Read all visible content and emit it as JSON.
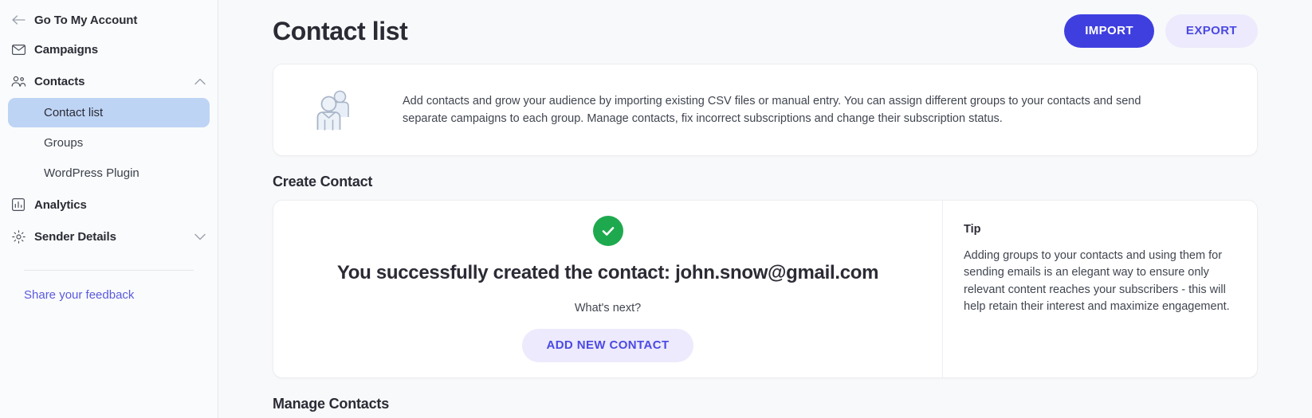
{
  "sidebar": {
    "back_link": {
      "label": "Go To My Account",
      "icon": "arrow-left-icon"
    },
    "groups": [
      {
        "label": "Campaigns",
        "icon": "envelope-icon",
        "chevron": null
      },
      {
        "label": "Contacts",
        "icon": "contacts-icon",
        "chevron": "chevron-up-icon"
      }
    ],
    "sub_items": [
      {
        "label": "Contact list",
        "active": true
      },
      {
        "label": "Groups",
        "active": false
      },
      {
        "label": "WordPress Plugin",
        "active": false
      }
    ],
    "groups_after": [
      {
        "label": "Analytics",
        "icon": "analytics-icon",
        "chevron": null
      },
      {
        "label": "Sender Details",
        "icon": "gear-icon",
        "chevron": "chevron-down-icon"
      }
    ],
    "feedback_label": "Share your feedback",
    "active_bg": "#bed4f5",
    "link_color": "#5a5ae0"
  },
  "header": {
    "title": "Contact list",
    "import_label": "IMPORT",
    "export_label": "EXPORT",
    "primary_color": "#3f3fe0",
    "secondary_bg": "#eceafc",
    "secondary_color": "#4b49e4"
  },
  "info_card": {
    "icon": "two-people-icon",
    "text": "Add contacts and grow your audience by importing existing CSV files or manual entry. You can assign different groups to your contacts and send separate campaigns to each group. Manage contacts, fix incorrect subscriptions and change their subscription status."
  },
  "create_section": {
    "title": "Create Contact",
    "success": {
      "icon": "check-circle-icon",
      "icon_color": "#1ea94e",
      "headline": "You successfully created the contact: john.snow@gmail.com",
      "whats_next": "What's next?",
      "add_button_label": "ADD NEW CONTACT"
    },
    "tip": {
      "title": "Tip",
      "body": "Adding groups to your contacts and using them for sending emails is an elegant way to ensure only relevant content reaches your subscribers - this will help retain their interest and maximize engagement."
    }
  },
  "bottom_section": {
    "title": "Manage Contacts"
  }
}
